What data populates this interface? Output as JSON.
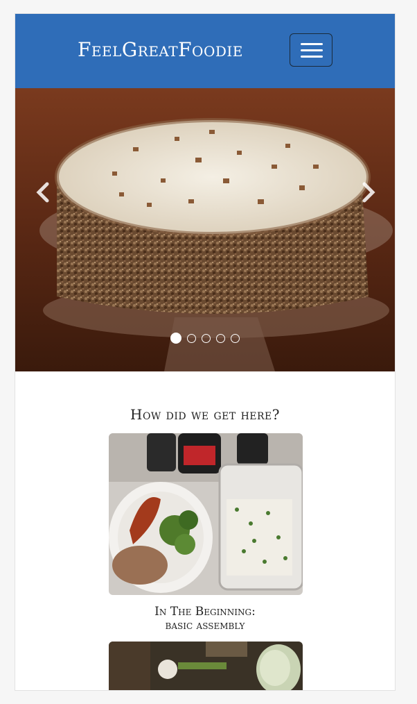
{
  "navbar": {
    "brand": "FeelGreatFoodie",
    "toggle_icon": "hamburger-menu-icon",
    "bg_color": "#2f6db8"
  },
  "carousel": {
    "prev_icon": "chevron-left-icon",
    "next_icon": "chevron-right-icon",
    "slide_count": 5,
    "active_slide": 1,
    "image_subject": "frosted cake with chopped nuts on glass cake stand"
  },
  "section": {
    "title": "How did we get here?"
  },
  "cards": [
    {
      "caption_line1": "In The Beginning:",
      "caption_line2": "basic assembly",
      "image_subject": "plate with sweet potato, broccoli and ground meat next to container of cabbage slaw"
    },
    {
      "image_subject": "kitchen counter with vegetables"
    }
  ]
}
